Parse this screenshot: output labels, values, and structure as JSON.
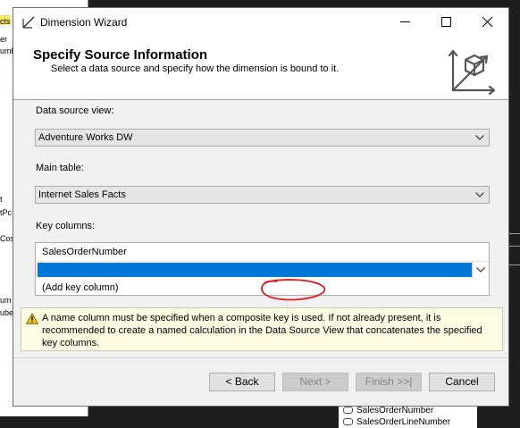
{
  "window": {
    "title": "Dimension Wizard"
  },
  "background": {
    "left_fragments": [
      "cts",
      "er",
      "umb",
      "t",
      "tPc",
      "Cos",
      "um",
      "uber"
    ],
    "fields": [
      "SalesOrderNumber",
      "SalesOrderLineNumber"
    ]
  },
  "header": {
    "title": "Specify Source Information",
    "subtitle": "Select a data source and specify how the dimension is bound to it."
  },
  "form": {
    "data_source_view_label": "Data source view:",
    "data_source_view_value": "Adventure Works DW",
    "main_table_label": "Main table:",
    "main_table_value": "Internet Sales Facts",
    "key_columns_label": "Key columns:",
    "key_columns": [
      "SalesOrderNumber",
      ""
    ],
    "add_key_column": "(Add key column)"
  },
  "warning": {
    "text": "A name column must be specified when a composite key is used. If not already present, it is recommended to create a named calculation in the Data Source View that concatenates the specified key columns."
  },
  "buttons": {
    "back": "< Back",
    "next": "Next >",
    "finish": "Finish >>|",
    "cancel": "Cancel"
  },
  "colors": {
    "selection": "#0078d7",
    "annotation": "#e0191f",
    "warning_bg": "#fefde4"
  }
}
